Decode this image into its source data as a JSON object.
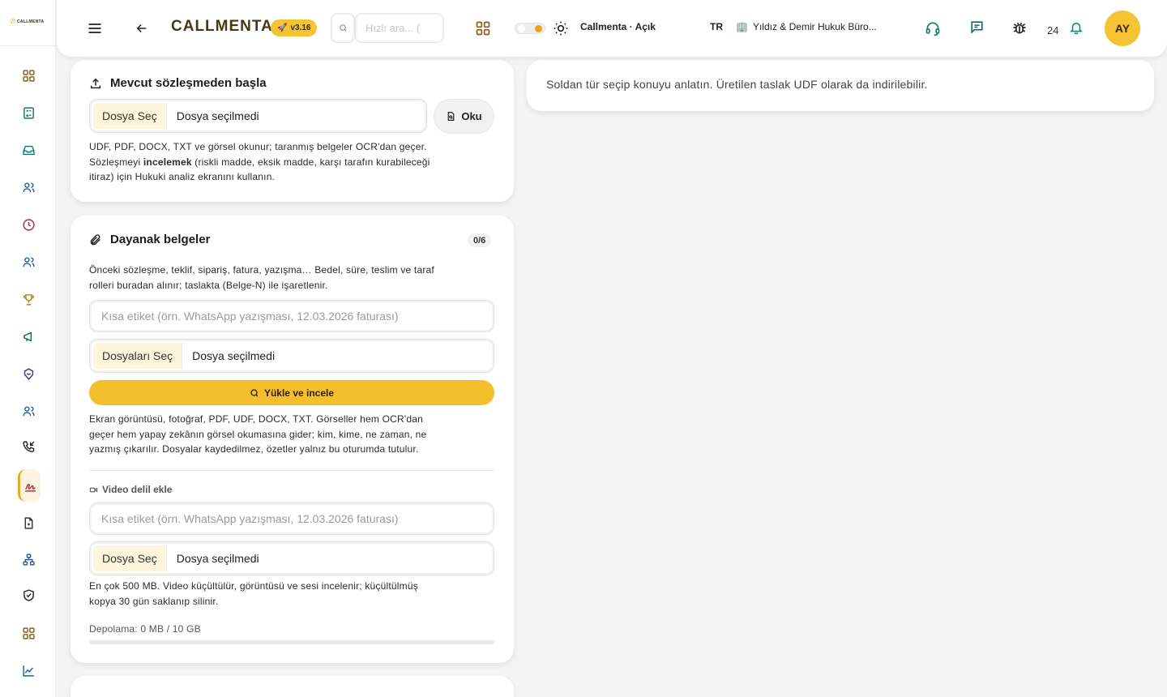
{
  "sidebar": {
    "logo_text": "CALLMENTA",
    "items": [
      {
        "icon": "grid-icon",
        "name": "sidebar-item-dashboard"
      },
      {
        "icon": "calculator-icon",
        "name": "sidebar-item-calculator"
      },
      {
        "icon": "inbox-icon",
        "name": "sidebar-item-inbox"
      },
      {
        "icon": "users-icon",
        "name": "sidebar-item-clients"
      },
      {
        "icon": "clock-icon",
        "name": "sidebar-item-history"
      },
      {
        "icon": "users-icon",
        "name": "sidebar-item-team"
      },
      {
        "icon": "trophy-icon",
        "name": "sidebar-item-achievements"
      },
      {
        "icon": "megaphone-icon",
        "name": "sidebar-item-campaigns"
      },
      {
        "icon": "brain-icon",
        "name": "sidebar-item-ai"
      },
      {
        "icon": "users-icon",
        "name": "sidebar-item-contacts"
      },
      {
        "icon": "phone-incoming-icon",
        "name": "sidebar-item-calls"
      },
      {
        "icon": "signature-icon",
        "name": "sidebar-item-contracts",
        "active": true
      },
      {
        "icon": "file-icon",
        "name": "sidebar-item-documents"
      },
      {
        "icon": "network-icon",
        "name": "sidebar-item-organization"
      },
      {
        "icon": "shield-icon",
        "name": "sidebar-item-security"
      },
      {
        "icon": "grid-icon",
        "name": "sidebar-item-apps"
      },
      {
        "icon": "chart-line-icon",
        "name": "sidebar-item-reports"
      }
    ]
  },
  "topbar": {
    "brand": "CALLMENTA",
    "version": "v3.16",
    "search_placeholder": "Hızlı ara... (",
    "theme_label": "Callmenta · Açık",
    "language": "TR",
    "firm_name": "Yıldız & Demir Hukuk Büro...",
    "notification_count": "24",
    "avatar_initials": "AY"
  },
  "colors": {
    "accent": "#f3bf2d",
    "brand_text": "#4a3616",
    "sidebar_icon": "#8a5a14",
    "sidebar_icon_alt": "#0d7a6a",
    "danger": "#c0392b"
  },
  "existing_contract": {
    "title": "Mevcut sözleşmeden başla",
    "file_button": "Dosya Seç",
    "file_name": "Dosya seçilmedi",
    "read_button": "Oku",
    "desc_line1": "UDF, PDF, DOCX, TXT ve görsel okunur; taranmış belgeler OCR'dan geçer.",
    "desc_line2_pre": "Sözleşmeyi ",
    "desc_line2_bold": "incelemek",
    "desc_line2_post": " (riskli madde, eksik madde, karşı tarafın kurabileceği",
    "desc_line3": "itiraz) için Hukuki analiz ekranını kullanın."
  },
  "supporting_docs": {
    "title": "Dayanak belgeler",
    "count": "0/6",
    "desc_line1": "Önceki sözleşme, teklif, sipariş, fatura, yazışma… Bedel, süre, teslim ve taraf",
    "desc_line2": "rolleri buradan alınır; taslakta (Belge-N) ile işaretlenir.",
    "label_placeholder": "Kısa etiket (örn. WhatsApp yazışması, 12.03.2026 faturası)",
    "files_button": "Dosyaları Seç",
    "files_name": "Dosya seçilmedi",
    "upload_button": "Yükle ve incele",
    "note_line1": "Ekran görüntüsü, fotoğraf, PDF, UDF, DOCX, TXT. Görseller hem OCR'dan",
    "note_line2": "geçer hem yapay zekânın görsel okumasına gider; kim, kime, ne zaman, ne",
    "note_line3": "yazmış çıkarılır. Dosyalar kaydedilmez, özetler yalnız bu oturumda tutulur.",
    "video_section": "Video delil ekle",
    "video_label_placeholder": "Kısa etiket (örn. WhatsApp yazışması, 12.03.2026 faturası)",
    "video_file_button": "Dosya Seç",
    "video_file_name": "Dosya seçilmedi",
    "video_note_line1": "En çok 500 MB. Video küçültülür, görüntüsü ve sesi incelenir; küçültülmüş",
    "video_note_line2": "kopya 30 gün saklanıp silinir.",
    "storage_text": "Depolama: 0 MB / 10 GB",
    "storage_fraction": 0
  },
  "right_panel": {
    "hint": "Soldan tür seçip konuyu anlatın. Üretilen taslak UDF olarak da indirilebilir."
  }
}
